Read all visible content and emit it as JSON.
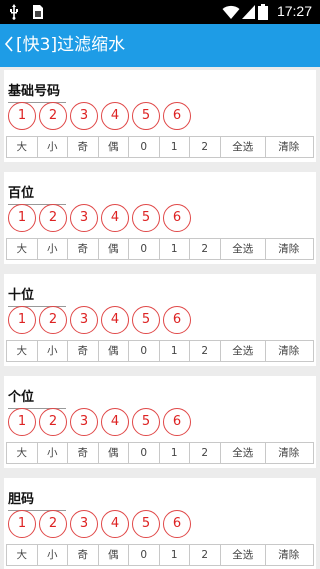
{
  "status_bar": {
    "time": "17:27",
    "icons": [
      "usb-icon",
      "sim-icon",
      "wifi-icon",
      "signal-icon",
      "battery-icon"
    ]
  },
  "app_bar": {
    "back_icon": "chevron-left-icon",
    "title": "[快3]过滤缩水"
  },
  "colors": {
    "accent": "#1e9ce6",
    "ball_red": "#e04848",
    "background": "#ececec"
  },
  "sections": [
    {
      "title": "基础号码",
      "numbers": [
        "1",
        "2",
        "3",
        "4",
        "5",
        "6"
      ],
      "filters": [
        "大",
        "小",
        "奇",
        "偶",
        "0",
        "1",
        "2",
        "全选",
        "清除"
      ]
    },
    {
      "title": "百位",
      "numbers": [
        "1",
        "2",
        "3",
        "4",
        "5",
        "6"
      ],
      "filters": [
        "大",
        "小",
        "奇",
        "偶",
        "0",
        "1",
        "2",
        "全选",
        "清除"
      ]
    },
    {
      "title": "十位",
      "numbers": [
        "1",
        "2",
        "3",
        "4",
        "5",
        "6"
      ],
      "filters": [
        "大",
        "小",
        "奇",
        "偶",
        "0",
        "1",
        "2",
        "全选",
        "清除"
      ]
    },
    {
      "title": "个位",
      "numbers": [
        "1",
        "2",
        "3",
        "4",
        "5",
        "6"
      ],
      "filters": [
        "大",
        "小",
        "奇",
        "偶",
        "0",
        "1",
        "2",
        "全选",
        "清除"
      ]
    },
    {
      "title": "胆码",
      "numbers": [
        "1",
        "2",
        "3",
        "4",
        "5",
        "6"
      ],
      "filters": [
        "大",
        "小",
        "奇",
        "偶",
        "0",
        "1",
        "2",
        "全选",
        "清除"
      ]
    }
  ]
}
